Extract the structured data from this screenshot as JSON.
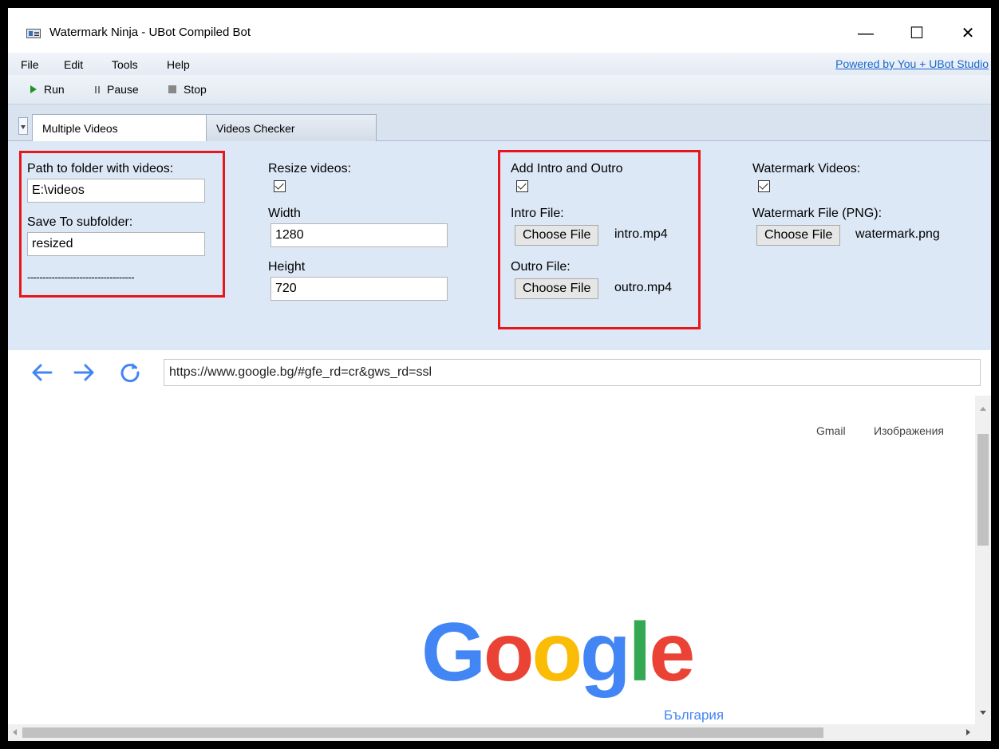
{
  "window": {
    "title": "Watermark Ninja - UBot Compiled Bot",
    "controls": {
      "minimize": "—",
      "maximize": "☐",
      "close": "✕"
    }
  },
  "menu": {
    "items": [
      "File",
      "Edit",
      "Tools",
      "Help"
    ],
    "powered_by": "Powered by You + UBot Studio"
  },
  "toolbar": {
    "run": "Run",
    "pause": "Pause",
    "stop": "Stop"
  },
  "tabs": [
    {
      "label": "Multiple Videos",
      "active": true
    },
    {
      "label": "Videos Checker",
      "active": false
    }
  ],
  "panel": {
    "folder": {
      "path_label": "Path to folder with videos:",
      "path_value": "E:\\videos",
      "subfolder_label": "Save To subfolder:",
      "subfolder_value": "resized",
      "separator": "-----------------------------------"
    },
    "resize": {
      "label": "Resize videos:",
      "checked": true,
      "width_label": "Width",
      "width_value": "1280",
      "height_label": "Height",
      "height_value": "720"
    },
    "intro_outro": {
      "label": "Add Intro and Outro",
      "checked": true,
      "intro_label": "Intro File:",
      "intro_button": "Choose File",
      "intro_file": "intro.mp4",
      "outro_label": "Outro File:",
      "outro_button": "Choose File",
      "outro_file": "outro.mp4"
    },
    "watermark": {
      "label": "Watermark Videos:",
      "checked": true,
      "file_label": "Watermark File (PNG):",
      "file_button": "Choose File",
      "file_name": "watermark.png"
    },
    "highlight_color": "#e8151b"
  },
  "browser": {
    "url": "https://www.google.bg/#gfe_rd=cr&gws_rd=ssl",
    "icons": [
      "back-arrow-icon",
      "forward-arrow-icon",
      "refresh-icon"
    ],
    "accent": "#4285f4"
  },
  "webpage": {
    "gmail": "Gmail",
    "images": "Изображения",
    "logo_letters": [
      "G",
      "o",
      "o",
      "g",
      "l",
      "e"
    ],
    "logo_colors": [
      "#4285f4",
      "#ea4335",
      "#fbbc05",
      "#4285f4",
      "#34a853",
      "#ea4335"
    ],
    "country": "България"
  }
}
